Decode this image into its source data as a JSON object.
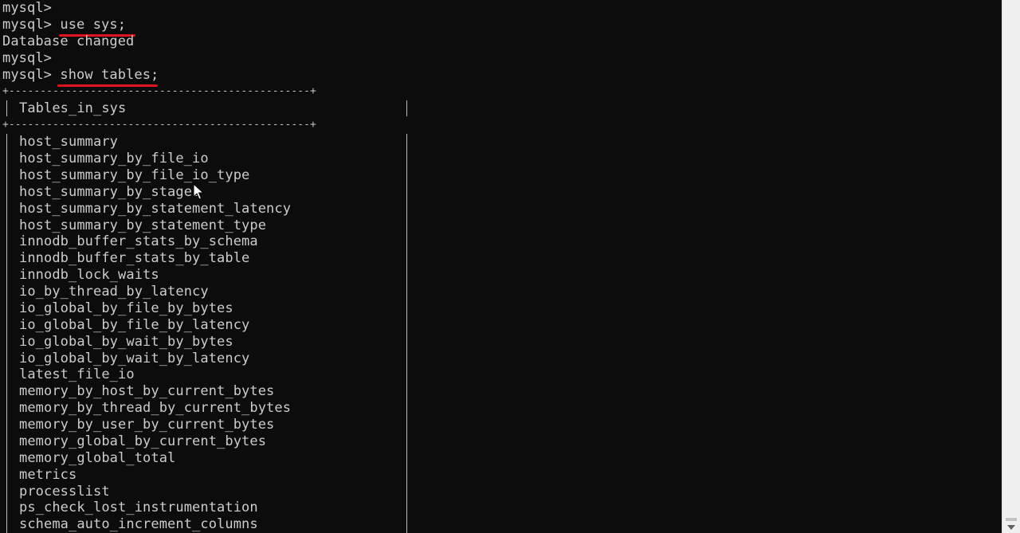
{
  "console": {
    "line0": "mysql>",
    "line1_prompt": "mysql>",
    "line1_cmd": "use sys;",
    "line2": "Database changed",
    "line3": "mysql>",
    "line4_prompt": "mysql>",
    "line4_cmd": "show tables;",
    "table_top_border": "+------------------------------------------------+",
    "table_header": "Tables_in_sys",
    "table_mid_border": "+------------------------------------------------+",
    "rows": [
      "host_summary",
      "host_summary_by_file_io",
      "host_summary_by_file_io_type",
      "host_summary_by_stages",
      "host_summary_by_statement_latency",
      "host_summary_by_statement_type",
      "innodb_buffer_stats_by_schema",
      "innodb_buffer_stats_by_table",
      "innodb_lock_waits",
      "io_by_thread_by_latency",
      "io_global_by_file_by_bytes",
      "io_global_by_file_by_latency",
      "io_global_by_wait_by_bytes",
      "io_global_by_wait_by_latency",
      "latest_file_io",
      "memory_by_host_by_current_bytes",
      "memory_by_thread_by_current_bytes",
      "memory_by_user_by_current_bytes",
      "memory_global_by_current_bytes",
      "memory_global_total",
      "metrics",
      "processlist",
      "ps_check_lost_instrumentation",
      "schema_auto_increment_columns"
    ]
  },
  "colors": {
    "background": "#0c0c0c",
    "text": "#cccccc",
    "annotation_underline": "#e0141e"
  },
  "icons": {
    "mouse_pointer": "arrow-cursor-icon",
    "scroll_down": "scroll-down-arrow-icon"
  }
}
